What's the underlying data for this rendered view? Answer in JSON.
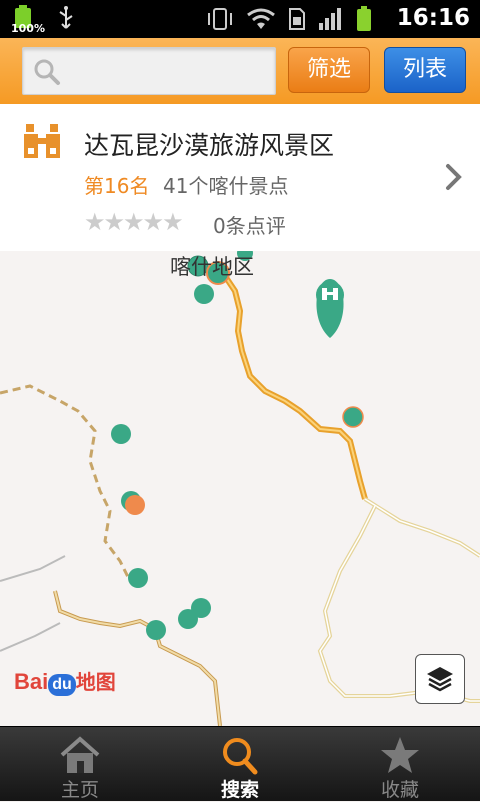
{
  "status_bar": {
    "battery_left_text": "100%",
    "time": "16:16"
  },
  "toolbar": {
    "search_placeholder": "",
    "filter_label": "筛选",
    "list_label": "列表"
  },
  "result_card": {
    "title": "达瓦昆沙漠旅游风景区",
    "rank": "第16名",
    "count": "41个喀什景点",
    "stars": "★★★★★",
    "star_count": 0,
    "reviews": "0条点评"
  },
  "map": {
    "region_label": "喀什地区",
    "logo_text_bai": "Bai",
    "logo_text_du": "du",
    "logo_text_map": "地图"
  },
  "tabs": [
    {
      "label": "主页",
      "icon": "home-icon",
      "active": false
    },
    {
      "label": "搜索",
      "icon": "search-icon",
      "active": true
    },
    {
      "label": "收藏",
      "icon": "star-icon",
      "active": false
    }
  ],
  "colors": {
    "accent_orange": "#f59a24",
    "list_blue": "#1b63c8",
    "marker_green": "#3aa886",
    "marker_orange": "#ef8a4c",
    "route_yellow": "#f0b030"
  }
}
